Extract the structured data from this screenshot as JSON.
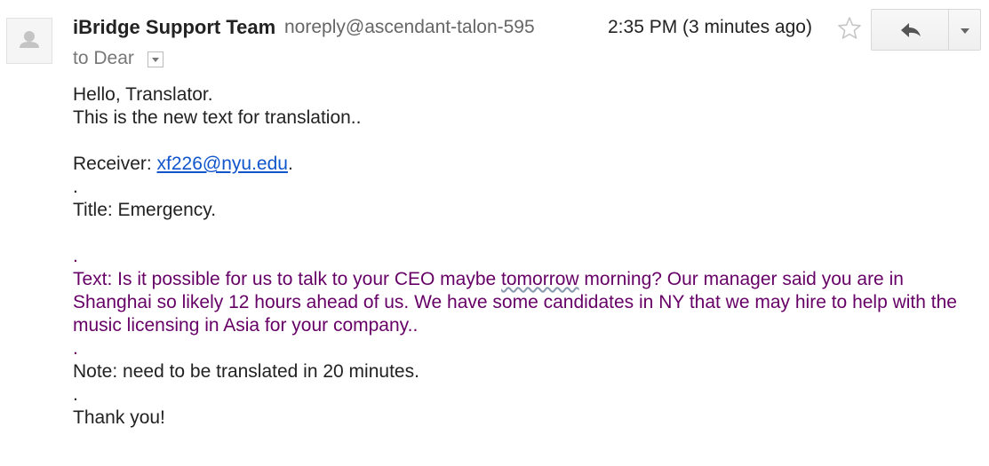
{
  "sender": {
    "name": "iBridge Support Team",
    "email": "noreply@ascendant-talon-595",
    "recipients": "to Dear"
  },
  "timestamp": "2:35 PM (3 minutes ago)",
  "icons": {
    "avatar": "default-user-avatar",
    "star": "star-outline-icon",
    "reply": "reply-arrow-icon",
    "more": "chevron-down-icon",
    "recipient_dropdown": "dropdown-arrow-icon"
  },
  "body": {
    "greeting": "Hello, Translator.",
    "intro": "This is the new text for translation..",
    "receiver_label": "Receiver: ",
    "receiver_email": "xf226@nyu.edu",
    "receiver_suffix": ".",
    "dot1": ".",
    "title": "Title: Emergency.",
    "dot2": ".",
    "text_before": "Text: Is it possible for us to talk to your CEO maybe ",
    "text_misspelled": "tomorrow",
    "text_after": " morning? Our manager said you are in Shanghai so likely 12 hours ahead of us.  We have some candidates in NY that we may hire to help with the music licensing in Asia for your company..",
    "dot3": ".",
    "note": "Note: need to be translated in 20 minutes.",
    "dot4": ".",
    "closing": "Thank you!"
  },
  "colors": {
    "link": "#1155cc",
    "quoted_text": "#660066",
    "sender_name": "#222222",
    "secondary_text": "#666666"
  }
}
